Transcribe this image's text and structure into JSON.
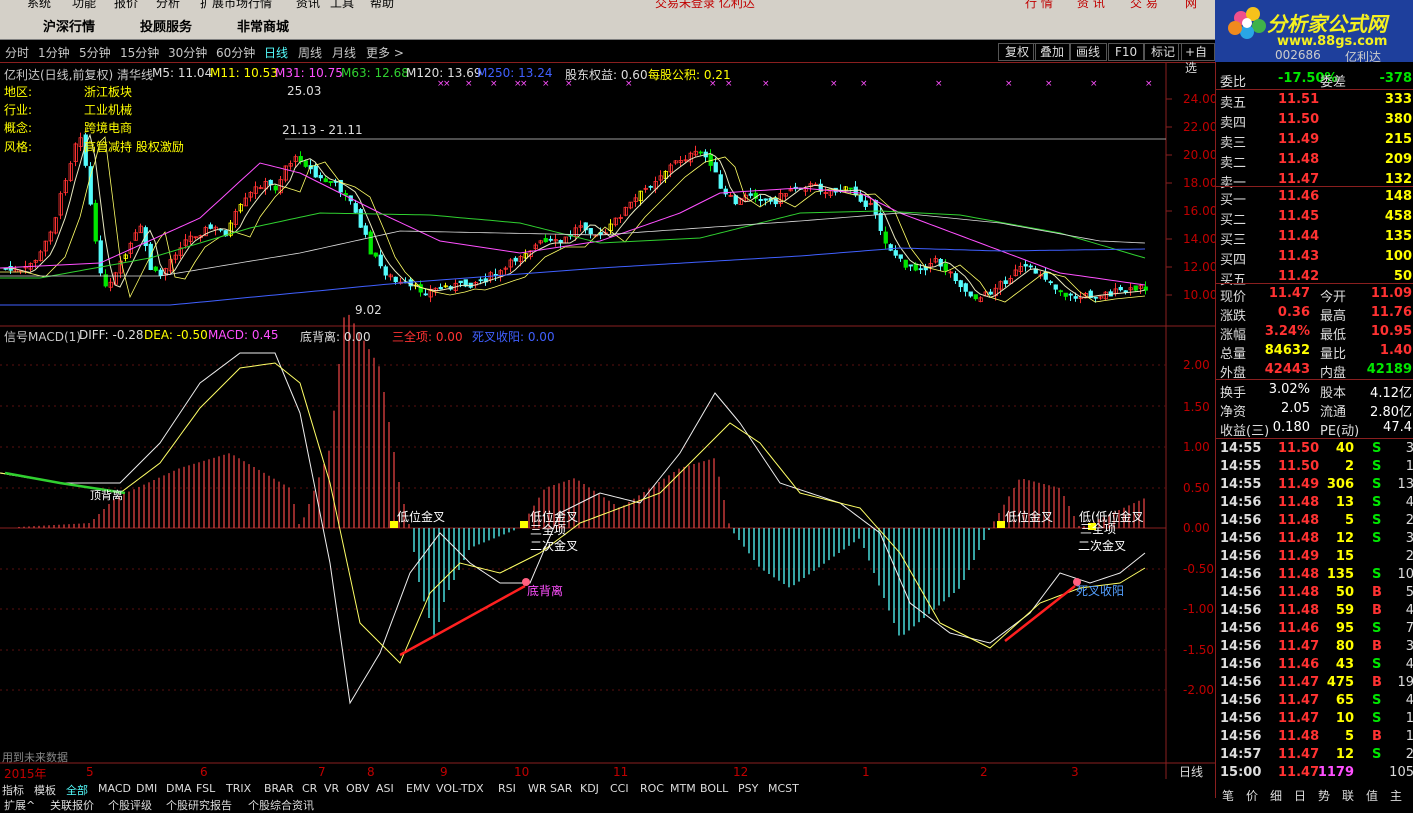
{
  "menu": [
    "系统",
    "功能",
    "报价",
    "分析",
    "扩展市场行情",
    "资讯",
    "工具",
    "帮助"
  ],
  "menu_title": "交易未登录  亿利达",
  "title_tabs": [
    "行 情",
    "资 讯",
    "交 易",
    "网"
  ],
  "nav": [
    "沪深行情",
    "投顾服务",
    "非常商城"
  ],
  "logo": {
    "text": "分析家公式网",
    "url": "www.88gs.com",
    "stock_code": "002686",
    "stock_name": "亿利达"
  },
  "periods": [
    "分时",
    "1分钟",
    "5分钟",
    "15分钟",
    "30分钟",
    "60分钟",
    "日线",
    "周线",
    "月线",
    "更多 >"
  ],
  "active_period": "日线",
  "right_buttons": [
    "复权",
    "叠加",
    "画线",
    "F10",
    "标记",
    "+自选"
  ],
  "main_info": {
    "name": "亿利达(日线,前复权) 清华线",
    "m5": "M5: 11.04",
    "m11": "M11: 10.53",
    "m31": "M31: 10.75",
    "m63": "M63: 12.68",
    "m120": "M120: 13.69",
    "m250": "M250: 13.24",
    "equity": "股东权益: 0.60",
    "pershare": "每股公积: 0.21"
  },
  "profile": [
    {
      "k": "地区:",
      "v": "浙江板块"
    },
    {
      "k": "行业:",
      "v": "工业机械"
    },
    {
      "k": "概念:",
      "v": "跨境电商"
    },
    {
      "k": "风格:",
      "v": "高管减持 股权激励"
    }
  ],
  "price_annotations": {
    "high": "25.03",
    "range": "21.13 - 21.11",
    "low": "9.02"
  },
  "price_axis": [
    "24.00",
    "22.00",
    "20.00",
    "18.00",
    "16.00",
    "14.00",
    "12.00",
    "10.00"
  ],
  "macd_info": {
    "name": "信号MACD(1)",
    "diff": "DIFF: -0.28",
    "dea": "DEA: -0.50",
    "macd": "MACD: 0.45",
    "dbl": "底背离: 0.00",
    "sqx": "三全项: 0.00",
    "fqsy": "死叉收阳: 0.00"
  },
  "macd_axis": [
    "2.00",
    "1.50",
    "1.00",
    "0.50",
    "0.00",
    "-0.50",
    "-1.00",
    "-1.50",
    "-2.00"
  ],
  "macd_labels": {
    "ltyc": "顶背离",
    "dwjc": "低位金叉",
    "dwjc2": "低位金叉",
    "sqx": "三全项",
    "ecjc": "二次金叉",
    "dbl": "底背离",
    "dwjc3": "低位金叉",
    "dwjc4": "低(低位金叉",
    "sqx2": "三全项",
    "ecjc2": "二次金叉",
    "sxsy": "死叉收阳"
  },
  "future_note": "用到未来数据",
  "months": [
    "2015年",
    "5",
    "6",
    "7",
    "8",
    "9",
    "10",
    "11",
    "12",
    "1",
    "2",
    "3"
  ],
  "timeframe_tag": "日线",
  "indicator_tabs": [
    "指标",
    "模板",
    "全部",
    "MACD",
    "DMI",
    "DMA",
    "FSL",
    "TRIX",
    "BRAR",
    "CR",
    "VR",
    "OBV",
    "ASI",
    "EMV",
    "VOL-TDX",
    "RSI",
    "WR",
    "SAR",
    "KDJ",
    "CCI",
    "ROC",
    "MTM",
    "BOLL",
    "PSY",
    "MCST"
  ],
  "bottom_tabs": [
    "扩展^",
    "关联报价",
    "个股评级",
    "个股研究报告",
    "个股综合资讯"
  ],
  "quote": {
    "weibi": {
      "k": "委比",
      "v": "-17.50%",
      "k2": "委差",
      "v2": "-378"
    },
    "asks": [
      {
        "k": "卖五",
        "p": "11.51",
        "v": "333"
      },
      {
        "k": "卖四",
        "p": "11.50",
        "v": "380"
      },
      {
        "k": "卖三",
        "p": "11.49",
        "v": "215"
      },
      {
        "k": "卖二",
        "p": "11.48",
        "v": "209"
      },
      {
        "k": "卖一",
        "p": "11.47",
        "v": "132"
      }
    ],
    "bids": [
      {
        "k": "买一",
        "p": "11.46",
        "v": "148"
      },
      {
        "k": "买二",
        "p": "11.45",
        "v": "458"
      },
      {
        "k": "买三",
        "p": "11.44",
        "v": "135"
      },
      {
        "k": "买四",
        "p": "11.43",
        "v": "100"
      },
      {
        "k": "买五",
        "p": "11.42",
        "v": "50"
      }
    ],
    "stats": [
      {
        "k": "现价",
        "v": "11.47",
        "k2": "今开",
        "v2": "11.09"
      },
      {
        "k": "涨跌",
        "v": "0.36",
        "k2": "最高",
        "v2": "11.76"
      },
      {
        "k": "涨幅",
        "v": "3.24%",
        "k2": "最低",
        "v2": "10.95"
      },
      {
        "k": "总量",
        "v": "84632",
        "k2": "量比",
        "v2": "1.40"
      },
      {
        "k": "外盘",
        "v": "42443",
        "k2": "内盘",
        "v2": "42189"
      }
    ],
    "finance": [
      {
        "k": "换手",
        "v": "3.02%",
        "k2": "股本",
        "v2": "4.12亿"
      },
      {
        "k": "净资",
        "v": "2.05",
        "k2": "流通",
        "v2": "2.80亿"
      },
      {
        "k": "收益(三)",
        "v": "0.180",
        "k2": "PE(动)",
        "v2": "47.4"
      }
    ],
    "ticks": [
      {
        "t": "14:55",
        "p": "11.50",
        "v": "40",
        "s": "S",
        "n": "3"
      },
      {
        "t": "14:55",
        "p": "11.50",
        "v": "2",
        "s": "S",
        "n": "1"
      },
      {
        "t": "14:55",
        "p": "11.49",
        "v": "306",
        "s": "S",
        "n": "13"
      },
      {
        "t": "14:56",
        "p": "11.48",
        "v": "13",
        "s": "S",
        "n": "4"
      },
      {
        "t": "14:56",
        "p": "11.48",
        "v": "5",
        "s": "S",
        "n": "2"
      },
      {
        "t": "14:56",
        "p": "11.48",
        "v": "12",
        "s": "S",
        "n": "3"
      },
      {
        "t": "14:56",
        "p": "11.49",
        "v": "15",
        "s": "",
        "n": "2"
      },
      {
        "t": "14:56",
        "p": "11.48",
        "v": "135",
        "s": "S",
        "n": "10"
      },
      {
        "t": "14:56",
        "p": "11.48",
        "v": "50",
        "s": "B",
        "n": "5"
      },
      {
        "t": "14:56",
        "p": "11.48",
        "v": "59",
        "s": "B",
        "n": "4"
      },
      {
        "t": "14:56",
        "p": "11.46",
        "v": "95",
        "s": "S",
        "n": "7"
      },
      {
        "t": "14:56",
        "p": "11.47",
        "v": "80",
        "s": "B",
        "n": "3"
      },
      {
        "t": "14:56",
        "p": "11.46",
        "v": "43",
        "s": "S",
        "n": "4"
      },
      {
        "t": "14:56",
        "p": "11.47",
        "v": "475",
        "s": "B",
        "n": "19"
      },
      {
        "t": "14:56",
        "p": "11.47",
        "v": "65",
        "s": "S",
        "n": "4"
      },
      {
        "t": "14:56",
        "p": "11.47",
        "v": "10",
        "s": "S",
        "n": "1"
      },
      {
        "t": "14:56",
        "p": "11.48",
        "v": "5",
        "s": "B",
        "n": "1"
      },
      {
        "t": "14:57",
        "p": "11.47",
        "v": "12",
        "s": "S",
        "n": "2"
      },
      {
        "t": "15:00",
        "p": "11.47",
        "v": "1179",
        "s": "",
        "n": "105"
      }
    ],
    "bottom_tabs": [
      "笔",
      "价",
      "细",
      "日",
      "势",
      "联",
      "值",
      "主"
    ]
  },
  "colors": {
    "up": "#ff3232",
    "down": "#00e600",
    "yellow": "#ffff00",
    "magenta": "#ff50ff",
    "cyan": "#54fcfc",
    "blue": "#4060ff",
    "green_ma": "#30d030",
    "white": "#ffffff"
  }
}
